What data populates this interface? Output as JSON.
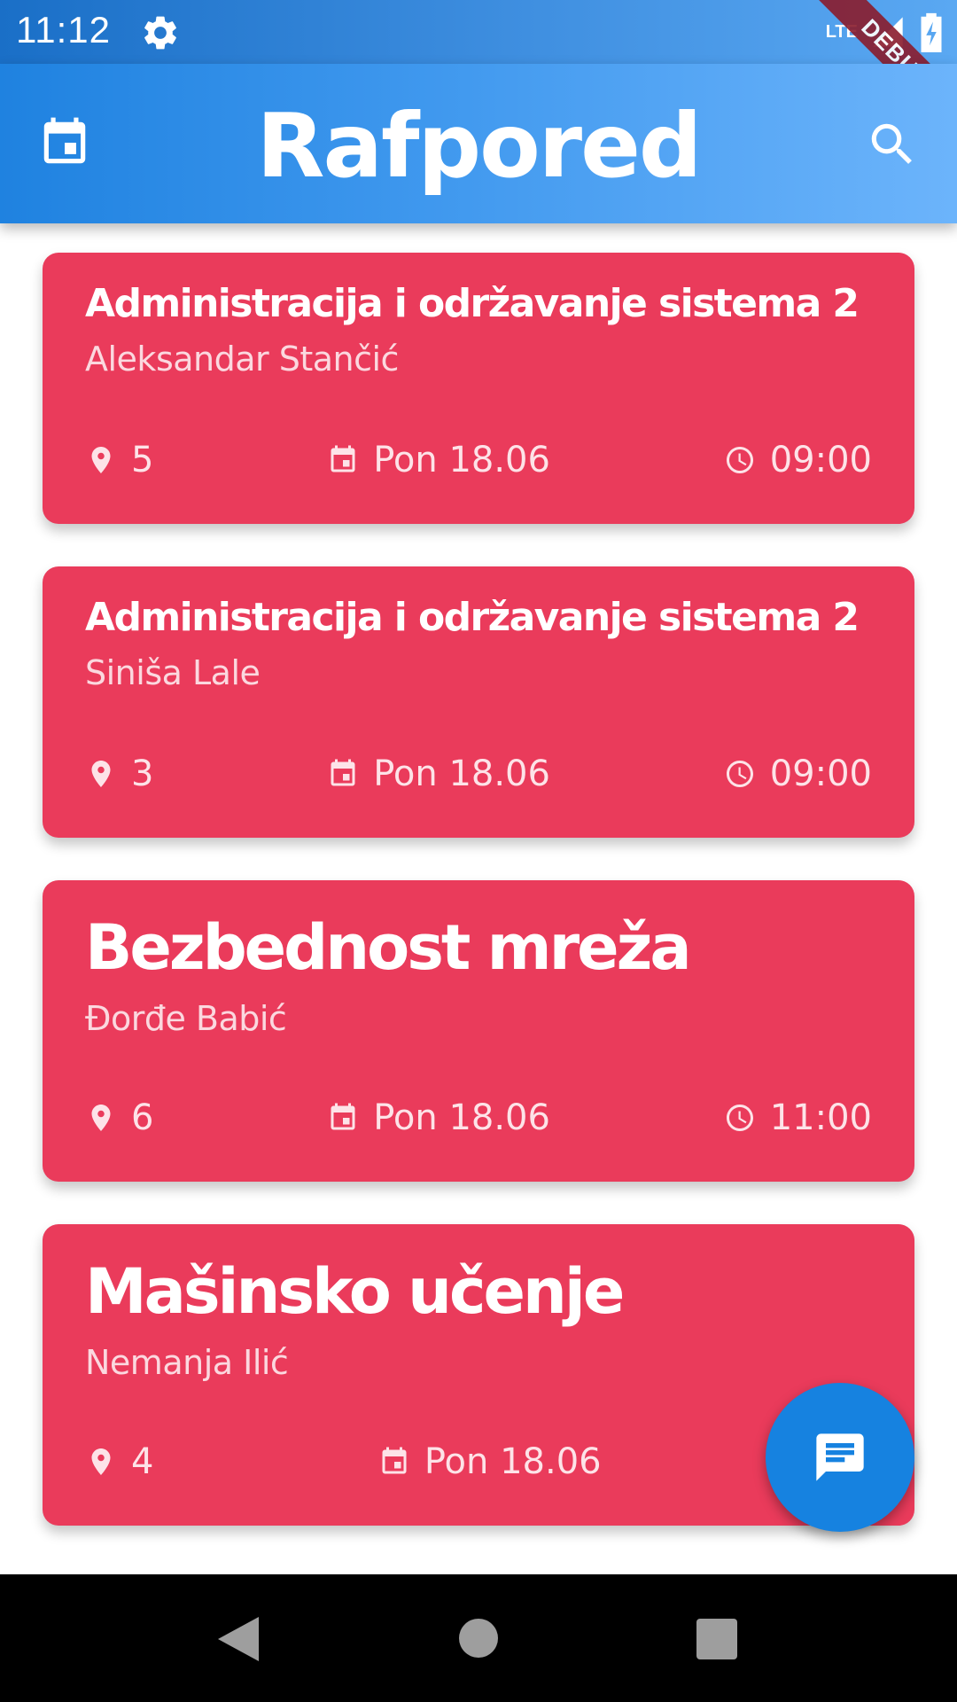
{
  "status_bar": {
    "time": "11:12",
    "network": "LTE"
  },
  "app_bar": {
    "title": "Rafpored",
    "left_icon": "calendar-icon",
    "right_icon": "search-icon"
  },
  "debug_banner": "DEBUG",
  "classes": [
    {
      "course": "Administracija i održavanje sistema 2",
      "professor": "Aleksandar Stančić",
      "room": "5",
      "date": "Pon 18.06",
      "time": "09:00"
    },
    {
      "course": "Administracija i održavanje sistema 2",
      "professor": "Siniša Lale",
      "room": "3",
      "date": "Pon 18.06",
      "time": "09:00"
    },
    {
      "course": "Bezbednost mreža",
      "professor": "Đorđe Babić",
      "room": "6",
      "date": "Pon 18.06",
      "time": "11:00"
    },
    {
      "course": "Mašinsko učenje",
      "professor": "Nemanja Ilić",
      "room": "4",
      "date": "Pon 18.06",
      "time": ""
    }
  ],
  "fab_icon": "message-icon",
  "colors": {
    "card": "#ea3b5b",
    "app_bar_start": "#1f82e0",
    "app_bar_end": "#6cb4fb",
    "fab": "#1682e0"
  }
}
